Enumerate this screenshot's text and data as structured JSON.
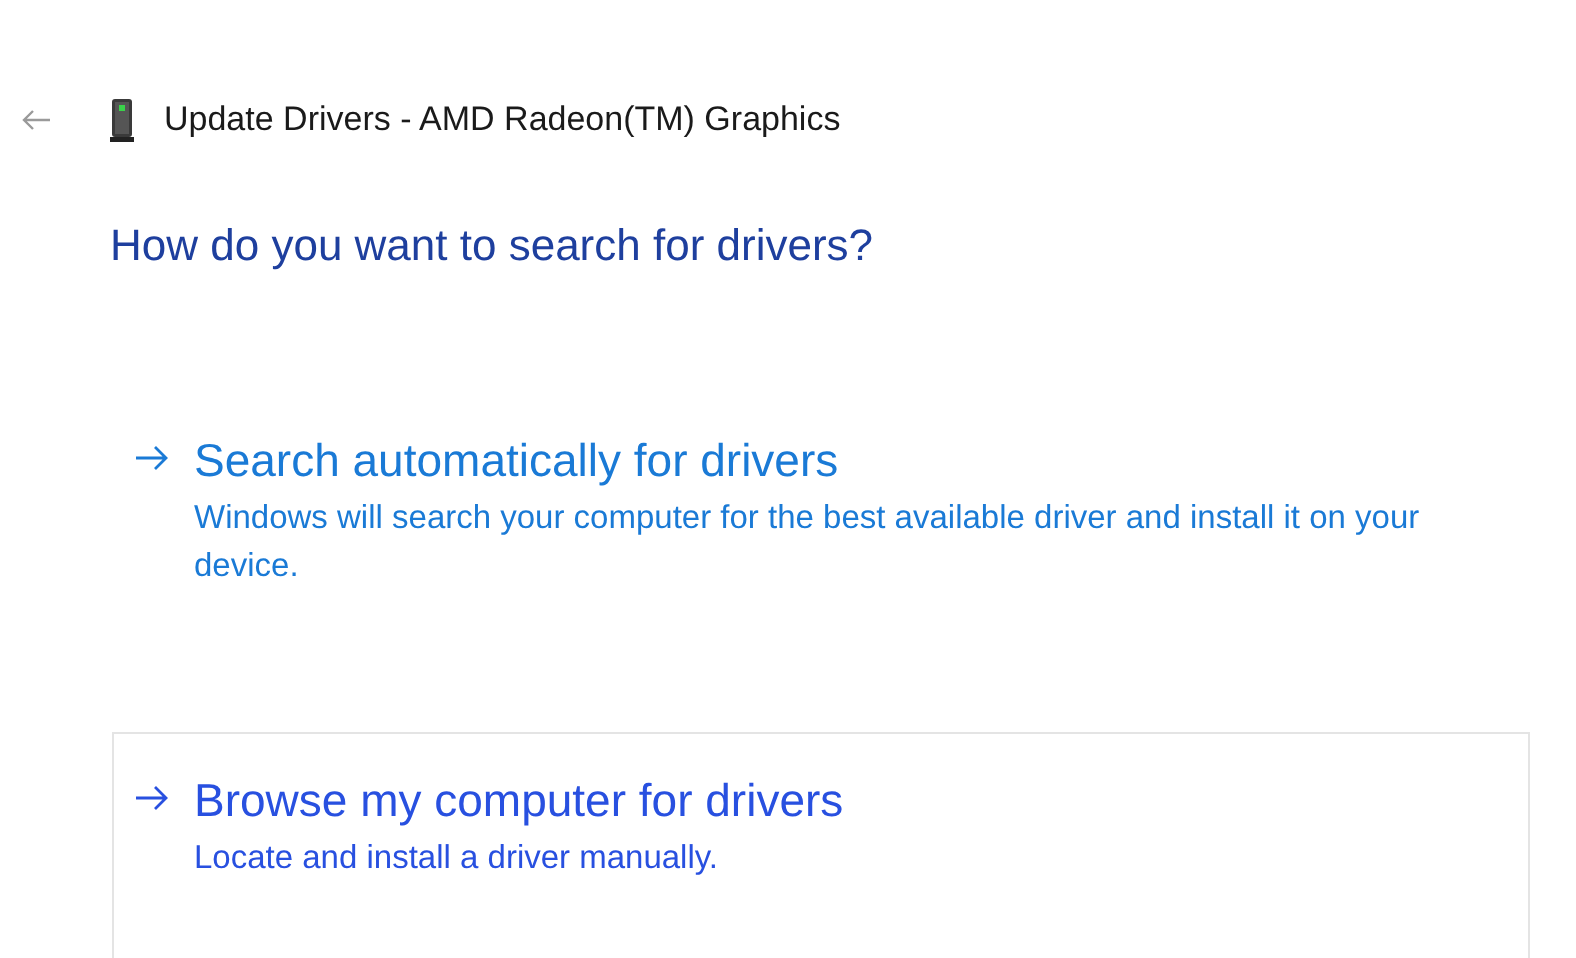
{
  "window": {
    "title": "Update Drivers - AMD Radeon(TM) Graphics"
  },
  "heading": "How do you want to search for drivers?",
  "options": [
    {
      "title": "Search automatically for drivers",
      "description": "Windows will search your computer for the best available driver and install it on your device.",
      "selected": false
    },
    {
      "title": "Browse my computer for drivers",
      "description": "Locate and install a driver manually.",
      "selected": true
    }
  ]
}
